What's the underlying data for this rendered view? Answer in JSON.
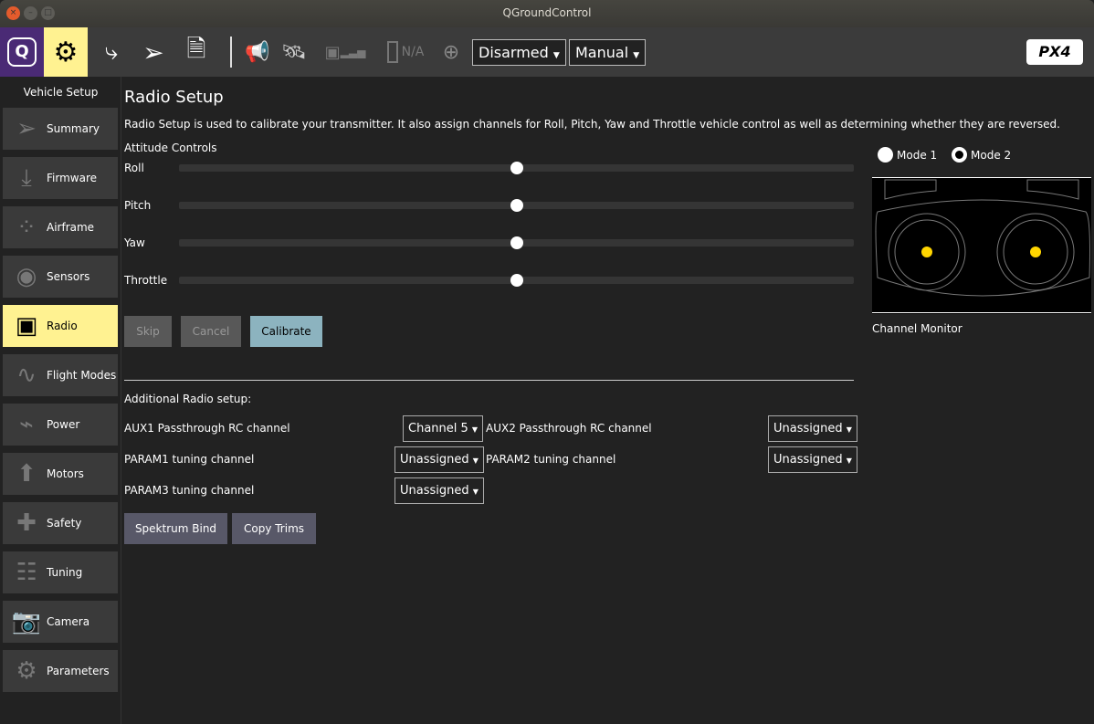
{
  "window": {
    "title": "QGroundControl"
  },
  "toolbar": {
    "battery_text": "N/A",
    "arm_state": "Disarmed",
    "flight_mode": "Manual",
    "brand_logo": "PX4 autopilot"
  },
  "sidebar": {
    "title": "Vehicle Setup",
    "items": [
      {
        "label": "Summary",
        "icon": "paper-plane-icon"
      },
      {
        "label": "Firmware",
        "icon": "download-icon"
      },
      {
        "label": "Airframe",
        "icon": "airframe-icon"
      },
      {
        "label": "Sensors",
        "icon": "sensors-icon"
      },
      {
        "label": "Radio",
        "icon": "radio-icon"
      },
      {
        "label": "Flight Modes",
        "icon": "flight-modes-icon"
      },
      {
        "label": "Power",
        "icon": "power-icon"
      },
      {
        "label": "Motors",
        "icon": "motors-icon"
      },
      {
        "label": "Safety",
        "icon": "safety-icon"
      },
      {
        "label": "Tuning",
        "icon": "tuning-icon"
      },
      {
        "label": "Camera",
        "icon": "camera-icon"
      },
      {
        "label": "Parameters",
        "icon": "parameters-icon"
      }
    ]
  },
  "main": {
    "title": "Radio Setup",
    "description": "Radio Setup is used to calibrate your transmitter. It also assign channels for Roll, Pitch, Yaw and Throttle vehicle control as well as determining whether they are reversed.",
    "attitude_title": "Attitude Controls",
    "channels": [
      {
        "label": "Roll",
        "value": 0.5
      },
      {
        "label": "Pitch",
        "value": 0.5
      },
      {
        "label": "Yaw",
        "value": 0.5
      },
      {
        "label": "Throttle",
        "value": 0.5
      }
    ],
    "skip": "Skip",
    "cancel": "Cancel",
    "calibrate": "Calibrate",
    "mode1": "Mode 1",
    "mode2": "Mode 2",
    "selected_mode": 2,
    "channel_monitor": "Channel Monitor",
    "additional_title": "Additional Radio setup:",
    "aux1_label": "AUX1 Passthrough RC channel",
    "aux1_value": "Channel 5",
    "aux2_label": "AUX2 Passthrough RC channel",
    "aux2_value": "Unassigned",
    "param1_label": "PARAM1 tuning channel",
    "param1_value": "Unassigned",
    "param2_label": "PARAM2 tuning channel",
    "param2_value": "Unassigned",
    "param3_label": "PARAM3 tuning channel",
    "param3_value": "Unassigned",
    "spektrum": "Spektrum Bind",
    "copy_trims": "Copy Trims"
  },
  "colors": {
    "accent": "#fff291",
    "qgc_purple": "#4a2a75",
    "calibrate": "#8cb3bf",
    "stick": "#ffd500"
  }
}
